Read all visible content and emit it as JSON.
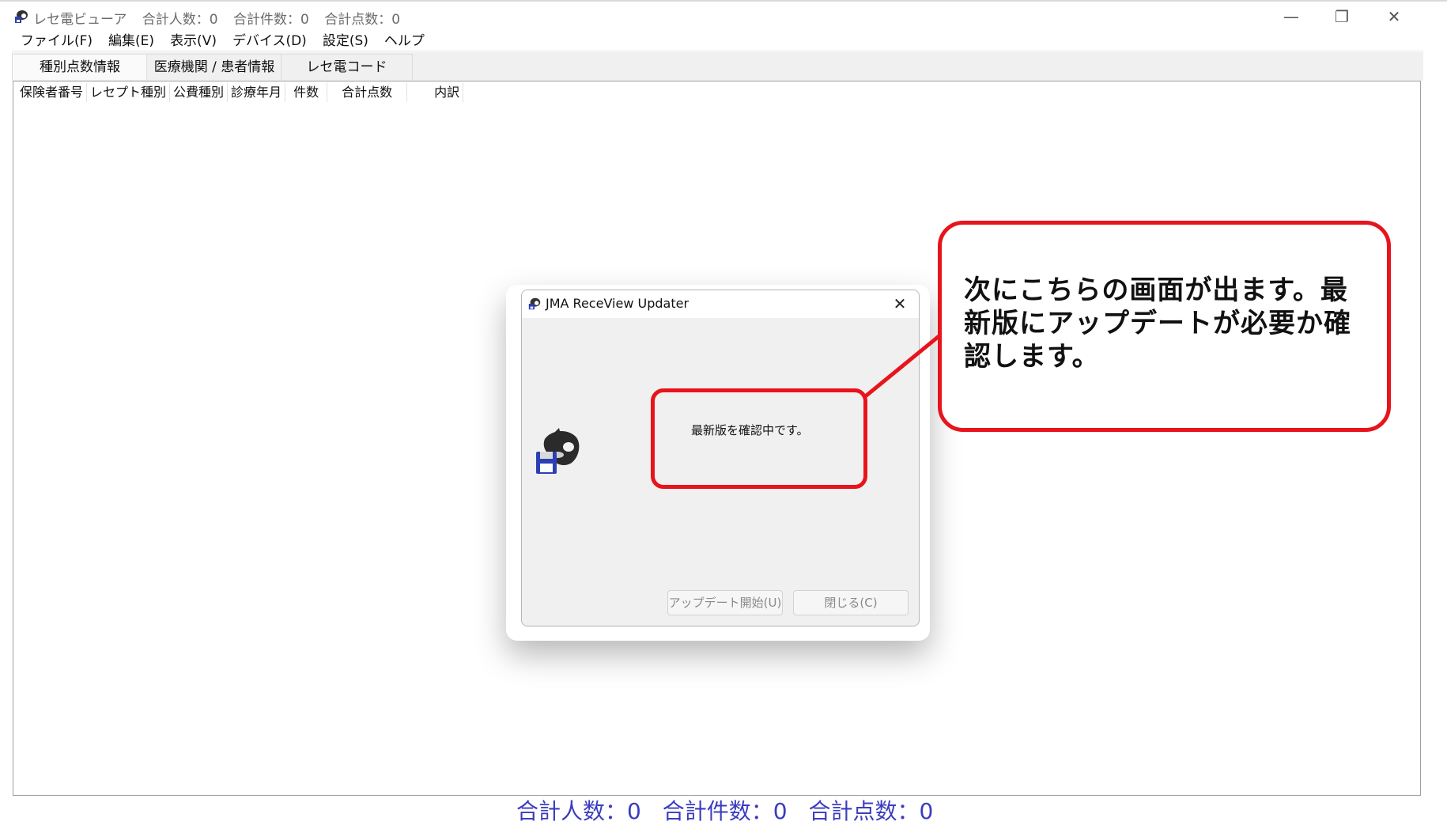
{
  "window": {
    "title": "レセ電ビューア",
    "title_stats": [
      "合計人数：0",
      "合計件数：0",
      "合計点数：0"
    ],
    "controls": {
      "minimize": "—",
      "maximize": "❐",
      "close": "✕"
    }
  },
  "menu": [
    "ファイル(F)",
    "編集(E)",
    "表示(V)",
    "デバイス(D)",
    "設定(S)",
    "ヘルプ"
  ],
  "tabs": [
    "種別点数情報",
    "医療機関 / 患者情報",
    "レセ電コード"
  ],
  "columns": [
    "保険者番号",
    "レセプト種別",
    "公費種別",
    "診療年月",
    "件数",
    "合計点数",
    "内訳"
  ],
  "status_stats": [
    "合計人数：0",
    "合計件数：0",
    "合計点数：0"
  ],
  "dialog": {
    "title": "JMA ReceView Updater",
    "close": "✕",
    "message": "最新版を確認中です。",
    "buttons": {
      "start_update": "アップデート開始(U)",
      "close": "閉じる(C)"
    }
  },
  "annotation": {
    "text": "次にこちらの画面が出ます。最新版にアップデートが必要か確認します。",
    "color": "#e8141b"
  },
  "colors": {
    "status_text": "#3b3cbf"
  }
}
